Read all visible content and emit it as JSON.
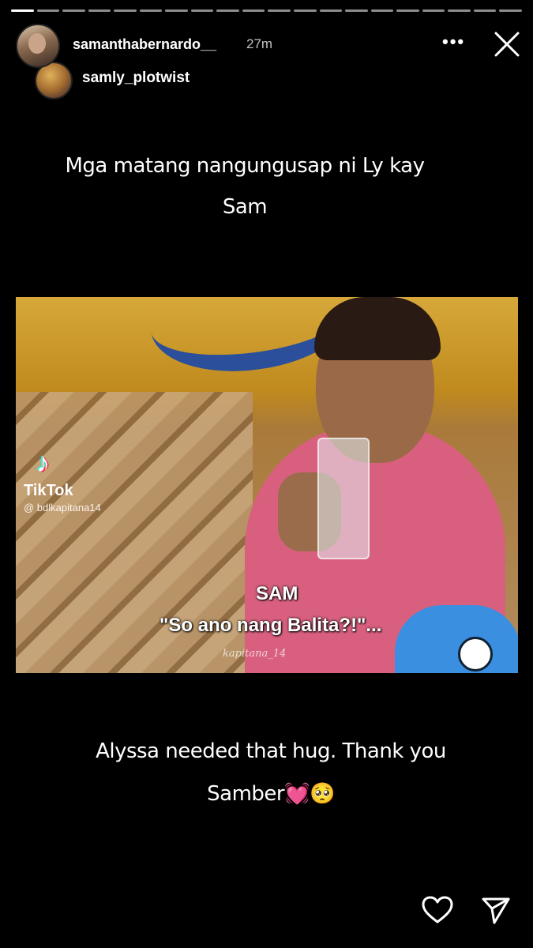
{
  "story": {
    "progress_segments": 6,
    "active_segment": 0,
    "username": "samanthabernardo__",
    "time_ago": "27m",
    "more_label": "•••",
    "reshared": {
      "username": "samly_plotwist",
      "caption_top": "Mga matang nangungusap ni Ly kay Sam",
      "caption_bottom": "Alyssa needed that hug. Thank you Samber💓🥺"
    },
    "video": {
      "tiktok_label": "TikTok",
      "tiktok_handle": "@ bdlkapitana14",
      "subtitle_name": "SAM",
      "subtitle_text": "\"So ano nang Balita?!\"...",
      "watermark": "kapitana_14"
    }
  },
  "icons": {
    "close": "close-icon",
    "like": "heart-icon",
    "share": "send-icon"
  }
}
